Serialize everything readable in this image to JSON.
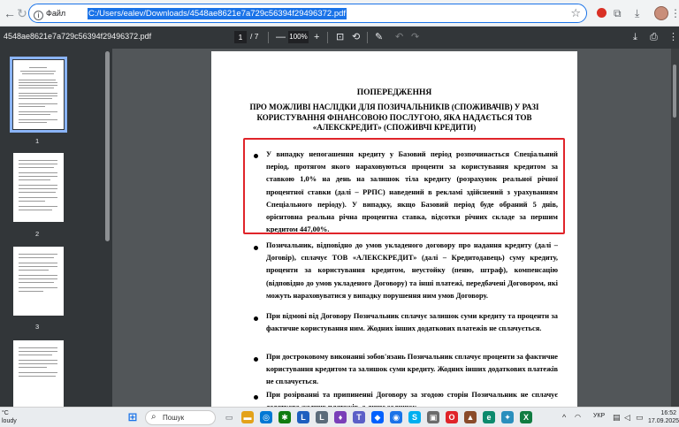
{
  "browser": {
    "info_label": "Файл",
    "url": "C:/Users/ealev/Downloads/4548ae8621e7a729c56394f29496372.pdf",
    "back": "←",
    "forward": "→",
    "reload": "↻",
    "star": "☆",
    "download": "⤓",
    "extensions": "⧉",
    "menu": "⋮"
  },
  "pdf_toolbar": {
    "filename": "4548ae8621e7a729c56394f29496372.pdf",
    "current_page": "1",
    "total_pages": "/ 7",
    "zoom_out": "—",
    "zoom": "100%",
    "zoom_in": "+",
    "fit": "⊡",
    "rotate": "⟲",
    "annotate": "✎",
    "undo": "↶",
    "redo": "↷",
    "download": "⤓",
    "print": "⎙",
    "more": "⋮"
  },
  "thumbnails": [
    {
      "label": "1",
      "selected": true
    },
    {
      "label": "2",
      "selected": false
    },
    {
      "label": "3",
      "selected": false
    },
    {
      "label": "",
      "selected": false
    }
  ],
  "document": {
    "title": "ПОПЕРЕДЖЕННЯ",
    "subtitle": "ПРО МОЖЛИВІ НАСЛІДКИ ДЛЯ ПОЗИЧАЛЬНИКІВ (СПОЖИВАЧІВ) У РАЗІ КОРИСТУВАННЯ ФІНАНСОВОЮ ПОСЛУГОЮ, ЯКА НАДАЄТЬСЯ ТОВ «АЛЕКСКРЕДИТ» (СПОЖИВЧІ КРЕДИТИ)",
    "bullets": [
      "У випадку непогашення кредиту у Базовий період розпочинається Спеціальний період, протягом якого нараховуються проценти за користування кредитом за ставкою 1,0% на день на залишок тіла кредиту (розрахунок реальної річної процентної ставки (далі – РРПС) наведений в рекламі здійснений з урахуванням Спеціального періоду). У випадку, якщо Базовий період буде обраний 5 днів, орієнтовна реальна річна процентна ставка, відсотки річних складе за першим кредитом 447,00%.",
      "Позичальник, відповідно до умов укладеного договору про надання кредиту (далі – Договір), сплачує ТОВ «АЛЕКСКРЕДИТ» (далі – Кредитодавець) суму кредиту, проценти за користування кредитом, неустойку (пеню, штраф), компенсацію (відповідно до умов укладеного Договору) та інші платежі, передбачені Договором, які можуть нараховуватися у випадку порушення ним умов Договору.",
      "При відмові від Договору Позичальник сплачує залишок суми кредиту та проценти за фактичне користування ним. Жодних інших додаткових платежів не сплачується.",
      "При достроковому виконанні зобов'язань Позичальник сплачує проценти за фактичне користування кредитом та залишок суми кредиту. Жодних інших додаткових платежів не сплачується.",
      "При розірванні та припиненні Договору за згодою сторін Позичальник не сплачує додатково жодних платежів, а лише залишок"
    ]
  },
  "taskbar": {
    "weather_temp": "°C",
    "weather_desc": "loudy",
    "search_placeholder": "Пошук",
    "apps": [
      {
        "name": "start",
        "glyph": "⊞",
        "color": "#1a73e8"
      },
      {
        "name": "task-view",
        "glyph": "▭",
        "color": "#5f6368"
      },
      {
        "name": "file-explorer",
        "glyph": "▬",
        "color": "#e3a21a"
      },
      {
        "name": "browser-blue",
        "glyph": "◎",
        "color": "#0078d4"
      },
      {
        "name": "app-green",
        "glyph": "✱",
        "color": "#107c10"
      },
      {
        "name": "app-l-blue",
        "glyph": "L",
        "color": "#1f5fbf"
      },
      {
        "name": "app-l-gray",
        "glyph": "L",
        "color": "#5b6b7a"
      },
      {
        "name": "app-purple",
        "glyph": "♦",
        "color": "#7a3fb8"
      },
      {
        "name": "teams",
        "glyph": "T",
        "color": "#5b5fc7"
      },
      {
        "name": "dropbox",
        "glyph": "◆",
        "color": "#0061fe"
      },
      {
        "name": "chrome",
        "glyph": "◉",
        "color": "#1a73e8"
      },
      {
        "name": "skype",
        "glyph": "S",
        "color": "#00aff0"
      },
      {
        "name": "app-gray",
        "glyph": "▣",
        "color": "#6b6b6b"
      },
      {
        "name": "opera",
        "glyph": "O",
        "color": "#e0242a"
      },
      {
        "name": "app-brown",
        "glyph": "▲",
        "color": "#8a4b2a"
      },
      {
        "name": "edge",
        "glyph": "e",
        "color": "#0c8a6d"
      },
      {
        "name": "app-teal",
        "glyph": "✦",
        "color": "#2a8fbd"
      },
      {
        "name": "excel",
        "glyph": "X",
        "color": "#107c41"
      }
    ],
    "tray_chevron": "^",
    "tray_lang": "УКР",
    "time": "16:52",
    "date": "17.09.2025"
  },
  "colors": {
    "highlight_box": "#e0242a",
    "url_selection": "#1a73e8"
  }
}
